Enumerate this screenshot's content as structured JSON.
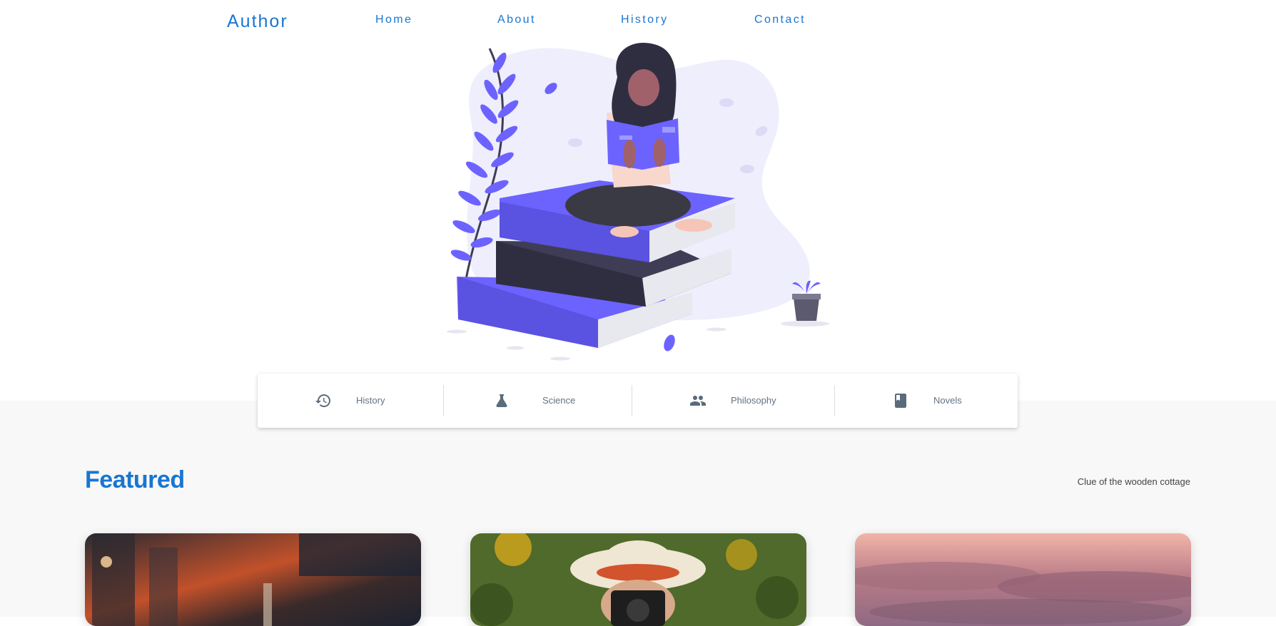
{
  "nav": {
    "brand": "Author",
    "links": [
      "Home",
      "About",
      "History",
      "Contact"
    ]
  },
  "categories": [
    {
      "label": "History",
      "icon": "history-icon"
    },
    {
      "label": "Science",
      "icon": "flask-icon"
    },
    {
      "label": "Philosophy",
      "icon": "people-icon"
    },
    {
      "label": "Novels",
      "icon": "book-icon"
    }
  ],
  "featured": {
    "title": "Featured",
    "link": "Clue of the wooden cottage"
  },
  "colors": {
    "accent": "#1976d2",
    "illustration_purple": "#6c63ff",
    "icon_gray": "#5a6b7b"
  }
}
